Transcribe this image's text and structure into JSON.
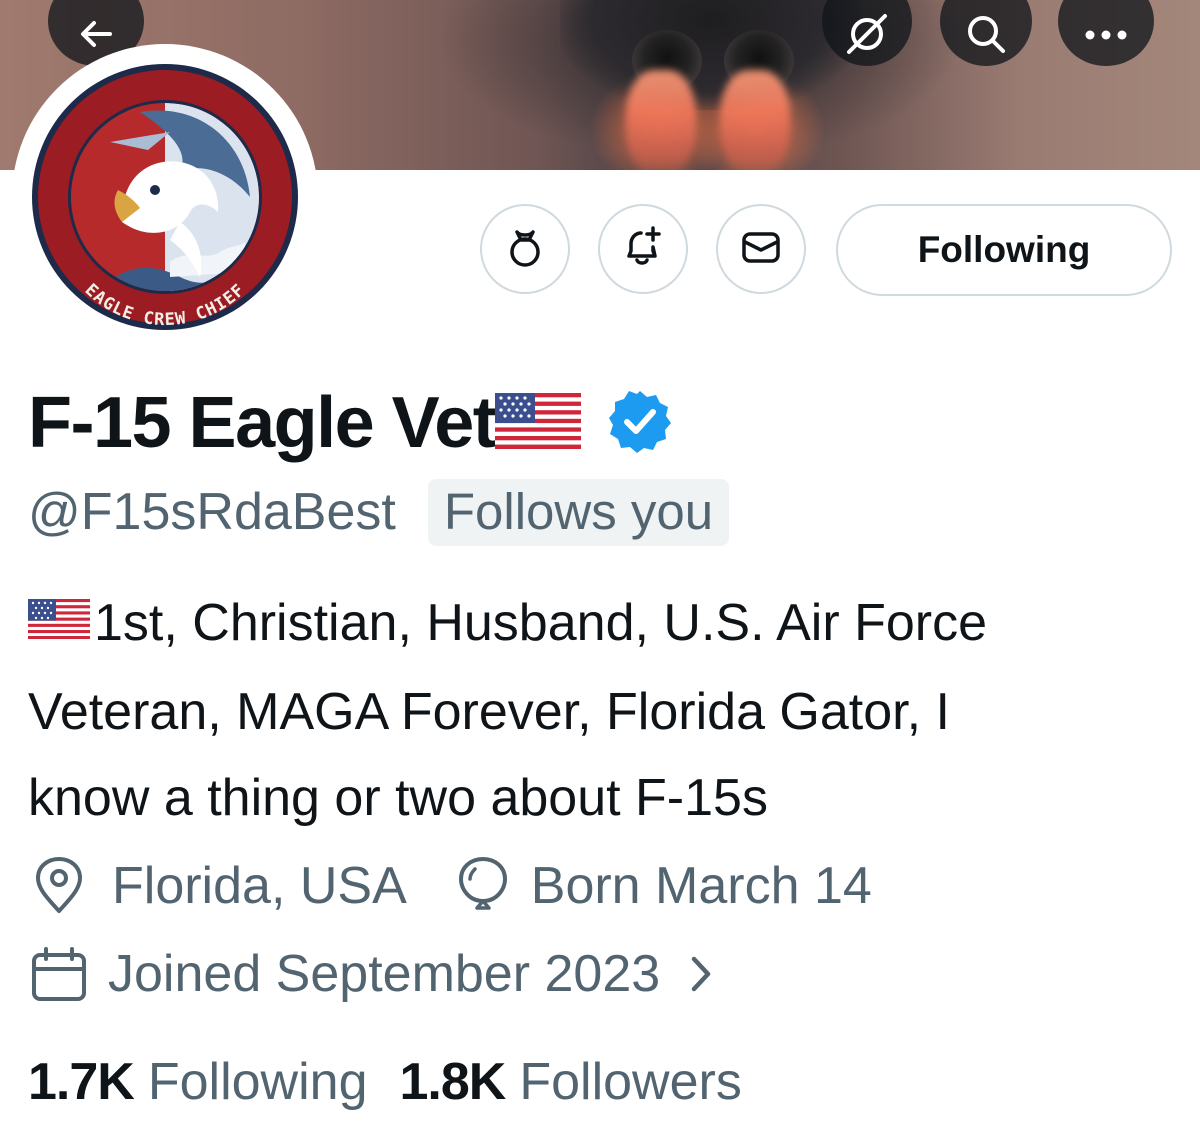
{
  "header": {
    "back_icon": "arrow-left-icon",
    "grok_icon": "slash-circle-icon",
    "search_icon": "search-icon",
    "more_icon": "more-horizontal-icon"
  },
  "avatar": {
    "patch_text": "EAGLE CREW CHIEF",
    "colors": {
      "ring": "#9b1c22",
      "inner": "#ffffff",
      "sky": "#5f7da0",
      "wave": "#3b5a86"
    }
  },
  "actions": {
    "grok_button_icon": "bag-icon",
    "notify_button_icon": "bell-plus-icon",
    "message_button_icon": "envelope-icon",
    "follow_label": "Following"
  },
  "profile": {
    "display_name": "F-15 Eagle Vet",
    "verified": true,
    "handle": "@F15sRdaBest",
    "follows_you_label": "Follows you",
    "bio_lines": [
      "1st, Christian, Husband, U.S. Air Force",
      "Veteran, MAGA Forever, Florida Gator, I",
      "know a thing or two about F-15s"
    ],
    "location": "Florida, USA",
    "birthday": "Born March 14",
    "joined": "Joined September 2023"
  },
  "stats": {
    "following_count": "1.7K",
    "following_label": "Following",
    "followers_count": "1.8K",
    "followers_label": "Followers"
  },
  "colors": {
    "text_primary": "#0f1419",
    "text_secondary": "#536471",
    "border": "#cfd9de",
    "verified_blue": "#1d9bf0",
    "chip_bg": "#eff3f4"
  }
}
